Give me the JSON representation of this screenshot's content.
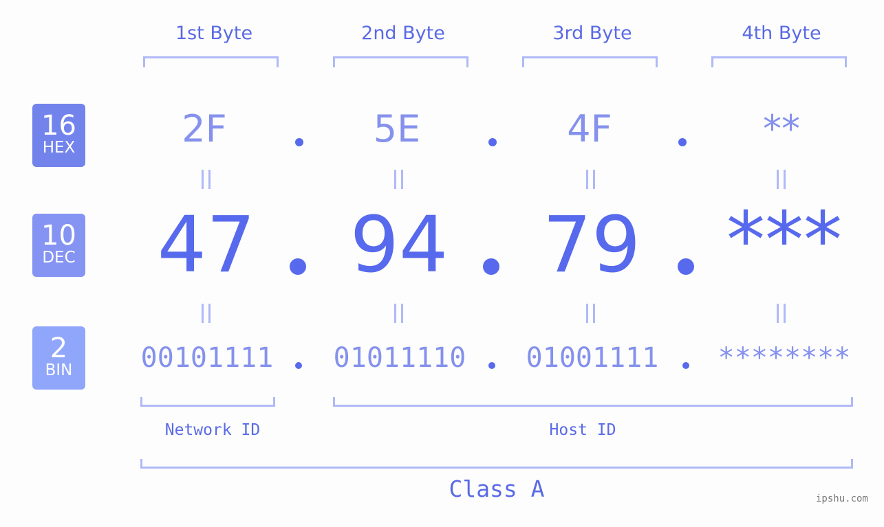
{
  "bytes": [
    {
      "label": "1st Byte",
      "hex": "2F",
      "dec": "47",
      "bin": "00101111"
    },
    {
      "label": "2nd Byte",
      "hex": "5E",
      "dec": "94",
      "bin": "01011110"
    },
    {
      "label": "3rd Byte",
      "hex": "4F",
      "dec": "79",
      "bin": "01001111"
    },
    {
      "label": "4th Byte",
      "hex": "**",
      "dec": "***",
      "bin": "********"
    }
  ],
  "bases": {
    "hex": {
      "num": "16",
      "label": "HEX",
      "color": "#7383ec"
    },
    "dec": {
      "num": "10",
      "label": "DEC",
      "color": "#8594f2"
    },
    "bin": {
      "num": "2",
      "label": "BIN",
      "color": "#90a6fa"
    }
  },
  "segments": {
    "network": "Network ID",
    "host": "Host ID",
    "class": "Class A"
  },
  "footer": "ipshu.com"
}
